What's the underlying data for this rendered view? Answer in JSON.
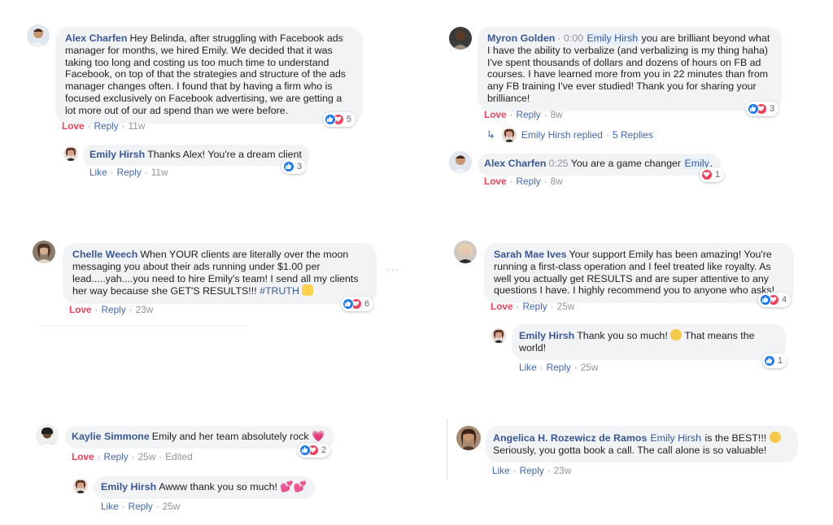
{
  "comments": {
    "c1": {
      "author": "Alex Charfen",
      "text": "Hey Belinda, after struggling with Facebook ads manager for months, we hired Emily. We decided that it was taking too long and costing us too much time to understand Facebook, on top of that the strategies and structure of the ads manager changes often. I found that by having a firm who is focused exclusively on Facebook advertising, we are getting a lot more out of our ad spend than we were before.",
      "reaction_count": "5",
      "action1": "Love",
      "reply": "Reply",
      "time": "11w"
    },
    "c1r": {
      "author": "Emily Hirsh",
      "text": "Thanks Alex! You're a dream client",
      "reaction_count": "3",
      "action1": "Like",
      "reply": "Reply",
      "time": "11w"
    },
    "c2": {
      "author": "Myron Golden",
      "timestamp": "· 0:00",
      "mention": "Emily Hirsh",
      "text": "you are brilliant beyond what I have the ability to verbalize (and verbalizing is my thing haha) I've spent thousands of dollars and dozens of hours on FB ad courses. I have learned more from you in 22 minutes than from any FB training I've ever studied! Thank you for sharing your brilliance!",
      "reaction_count": "3",
      "action1": "Love",
      "reply": "Reply",
      "time": "8w",
      "replied_by": "Emily Hirsh replied",
      "replies_count": "5 Replies"
    },
    "c2b": {
      "author": "Alex Charfen",
      "timestamp": "0:25",
      "text": "You are a game changer",
      "mention": "Emily",
      "reaction_count": "1",
      "action1": "Love",
      "reply": "Reply",
      "time": "8w"
    },
    "c3": {
      "author": "Chelle Weech",
      "text": "When YOUR clients are literally over the moon messaging you about their ads running under $1.00 per lead.....yah....you need to hire Emily's team! I send all my clients her way because she GET'S RESULTS!!!",
      "hashtag": "#TRUTH",
      "reaction_count": "6",
      "action1": "Love",
      "reply": "Reply",
      "time": "23w"
    },
    "c4": {
      "author": "Sarah Mae Ives",
      "text": "Your support Emily has been amazing! You're running a first-class operation and I feel treated like royalty. As well you actually get RESULTS and are super attentive to any questions I have. I highly recommend you to anyone who asks!",
      "reaction_count": "4",
      "action1": "Love",
      "reply": "Reply",
      "time": "25w"
    },
    "c4r": {
      "author": "Emily Hirsh",
      "text": "Thank you so much!",
      "text2": "That means the world!",
      "reaction_count": "1",
      "action1": "Like",
      "reply": "Reply",
      "time": "25w"
    },
    "c5": {
      "author": "Kaylie Simmone",
      "text": "Emily and her team absolutely rock",
      "reaction_count": "2",
      "action1": "Love",
      "reply": "Reply",
      "time": "25w",
      "edited": "Edited"
    },
    "c5r": {
      "author": "Emily Hirsh",
      "text": "Awww thank you so much!",
      "action1": "Like",
      "reply": "Reply",
      "time": "25w"
    },
    "c6": {
      "author": "Angelica H. Rozewicz de Ramos",
      "mention": "Emily Hirsh",
      "text": "is the BEST!!!",
      "text2": "Seriously, you gotta book a call. The call alone is so valuable!",
      "action1": "Like",
      "reply": "Reply",
      "time": "23w"
    }
  },
  "colors": {
    "link": "#385898",
    "love": "#f33e58",
    "like": "#1877f2",
    "bubble": "#f2f3f5",
    "meta": "#90949c"
  },
  "icons": [
    "like-reaction-icon",
    "love-reaction-icon",
    "reply-arrow-icon",
    "smile-emoji-icon",
    "raised-hands-emoji-icon",
    "hearts-emoji-icon",
    "more-options-icon"
  ]
}
